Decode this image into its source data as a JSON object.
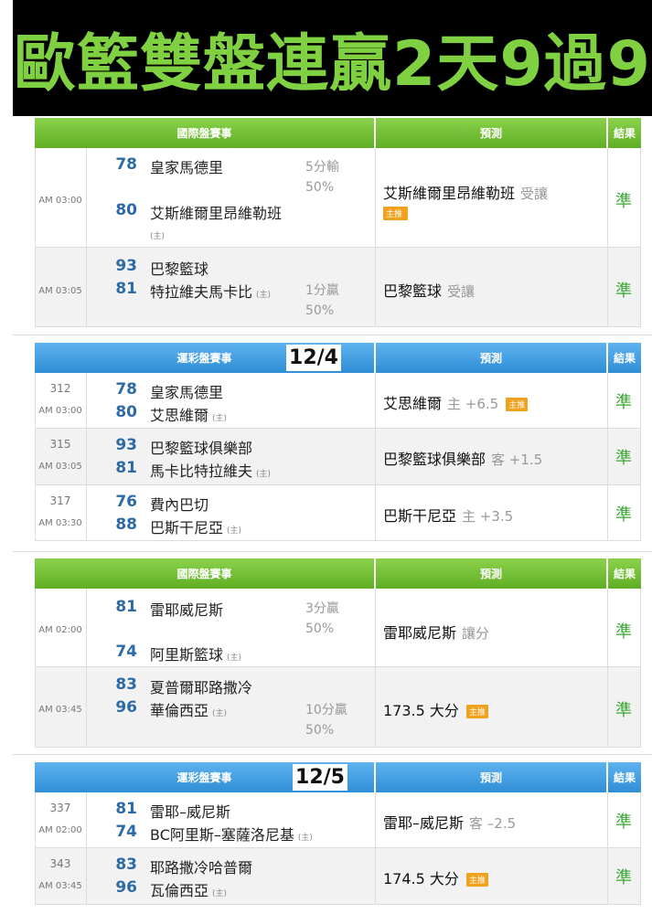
{
  "banner": {
    "title": "歐籃雙盤連贏2天9過9"
  },
  "home_mark": "(主)",
  "tables": [
    {
      "id": "intl-1",
      "header": {
        "event": "國際盤賽事",
        "prediction": "預測",
        "result": "結果"
      },
      "rows": [
        {
          "time": "AM 03:00",
          "score1": "78",
          "team1": "皇家馬德里",
          "score2": "80",
          "team2": "艾斯維爾里昂維勒班",
          "home_note": "(主)",
          "line1": "5分輸",
          "line2": "50%",
          "prediction": "艾斯維爾里昂維勒班",
          "prediction_sub": "受讓",
          "tag": "主推",
          "result": "準"
        },
        {
          "time": "AM 03:05",
          "score1": "93",
          "team1": "巴黎籃球",
          "score2": "81",
          "team2": "特拉維夫馬卡比",
          "line1": "1分贏",
          "line2": "50%",
          "prediction": "巴黎籃球",
          "prediction_sub": "受讓",
          "result": "準"
        }
      ]
    },
    {
      "id": "lottery-1",
      "header": {
        "event": "運彩盤賽事",
        "date": "12/4",
        "prediction": "預測",
        "result": "結果"
      },
      "rows": [
        {
          "no": "312",
          "time": "AM 03:00",
          "score1": "78",
          "team1": "皇家馬德里",
          "score2": "80",
          "team2": "艾思維爾",
          "prediction": "艾思維爾",
          "prediction_sub": "主 +6.5",
          "tag": "主推",
          "result": "準"
        },
        {
          "no": "315",
          "time": "AM 03:05",
          "score1": "93",
          "team1": "巴黎籃球俱樂部",
          "score2": "81",
          "team2": "馬卡比特拉維夫",
          "prediction": "巴黎籃球俱樂部",
          "prediction_sub": "客 +1.5",
          "result": "準"
        },
        {
          "no": "317",
          "time": "AM 03:30",
          "score1": "76",
          "team1": "費內巴切",
          "score2": "88",
          "team2": "巴斯干尼亞",
          "prediction": "巴斯干尼亞",
          "prediction_sub": "主 +3.5",
          "result": "準"
        }
      ]
    },
    {
      "id": "intl-2",
      "header": {
        "event": "國際盤賽事",
        "prediction": "預測",
        "result": "結果"
      },
      "rows": [
        {
          "time": "AM 02:00",
          "score1": "81",
          "team1": "雷耶威尼斯",
          "score2": "74",
          "team2": "阿里斯籃球",
          "line1": "3分贏",
          "line2": "50%",
          "prediction": "雷耶威尼斯",
          "prediction_sub": "讓分",
          "result": "準"
        },
        {
          "time": "AM 03:45",
          "score1": "83",
          "team1": "夏普爾耶路撒冷",
          "score2": "96",
          "team2": "華倫西亞",
          "line1": "10分贏",
          "line2": "50%",
          "prediction": "173.5 大分",
          "tag": "主推",
          "result": "準"
        }
      ]
    },
    {
      "id": "lottery-2",
      "header": {
        "event": "運彩盤賽事",
        "date": "12/5",
        "prediction": "預測",
        "result": "結果"
      },
      "rows": [
        {
          "no": "337",
          "time": "AM 02:00",
          "score1": "81",
          "team1": "雷耶–威尼斯",
          "score2": "74",
          "team2": "BC阿里斯–塞薩洛尼基",
          "prediction": "雷耶–威尼斯",
          "prediction_sub": "客 –2.5",
          "result": "準"
        },
        {
          "no": "343",
          "time": "AM 03:45",
          "score1": "83",
          "team1": "耶路撒冷哈普爾",
          "score2": "96",
          "team2": "瓦倫西亞",
          "prediction": "174.5 大分",
          "tag": "主推",
          "result": "準"
        }
      ]
    }
  ]
}
